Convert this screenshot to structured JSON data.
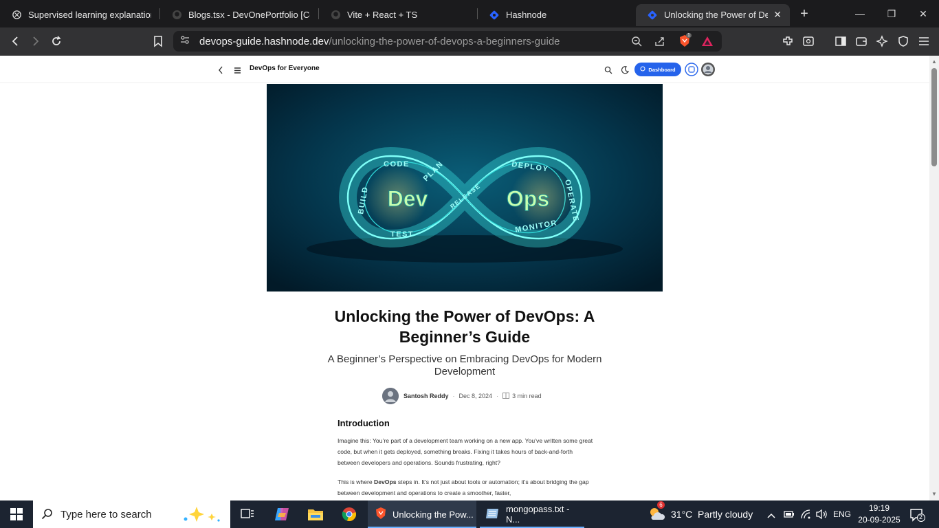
{
  "browser": {
    "tabs": [
      {
        "label": "Supervised learning explanation",
        "icon": "chatgpt-icon"
      },
      {
        "label": "Blogs.tsx - DevOnePortfolio [Code",
        "icon": "github-icon"
      },
      {
        "label": "Vite + React + TS",
        "icon": "github-icon"
      },
      {
        "label": "Hashnode",
        "icon": "hashnode-icon"
      },
      {
        "label": "Unlocking the Power of DevO",
        "icon": "hashnode-icon",
        "active": true
      }
    ],
    "url_domain": "devops-guide.hashnode.dev",
    "url_path": "/unlocking-the-power-of-devops-a-beginners-guide",
    "brave_badge": "1"
  },
  "site": {
    "blog_name": "DevOps for Everyone",
    "dashboard_label": "Dashboard"
  },
  "hero": {
    "left_word": "Dev",
    "right_word": "Ops",
    "loop_labels": [
      "CODE",
      "PLAN",
      "RELEASE",
      "DEPLOY",
      "BUILD",
      "TEST",
      "OPERATE",
      "MONITOR"
    ]
  },
  "article": {
    "title": "Unlocking the Power of DevOps: A Beginner’s Guide",
    "subtitle": "A Beginner’s Perspective on Embracing DevOps for Modern Development",
    "author": "Santosh Reddy",
    "date": "Dec 8, 2024",
    "read_time": "3 min read",
    "section_heading": "Introduction",
    "para1": "Imagine this: You’re part of a development team working on a new app. You’ve written some great code, but when it gets deployed, something breaks. Fixing it takes hours of back-and-forth between developers and operations. Sounds frustrating, right?",
    "para2_pre": "This is where ",
    "para2_bold": "DevOps",
    "para2_post": " steps in. It’s not just about tools or automation; it’s about bridging the gap between development and operations to create a smoother, faster,"
  },
  "taskbar": {
    "search_placeholder": "Type here to search",
    "apps": [
      {
        "label": "Unlocking the Pow...",
        "icon": "brave-icon"
      },
      {
        "label": "mongopass.txt - N...",
        "icon": "notepad-icon"
      }
    ],
    "weather": "31°C  Partly cloudy",
    "weather_badge": "6",
    "lang": "ENG",
    "time": "19:19",
    "date": "20-09-2025",
    "notif_count": "2"
  }
}
